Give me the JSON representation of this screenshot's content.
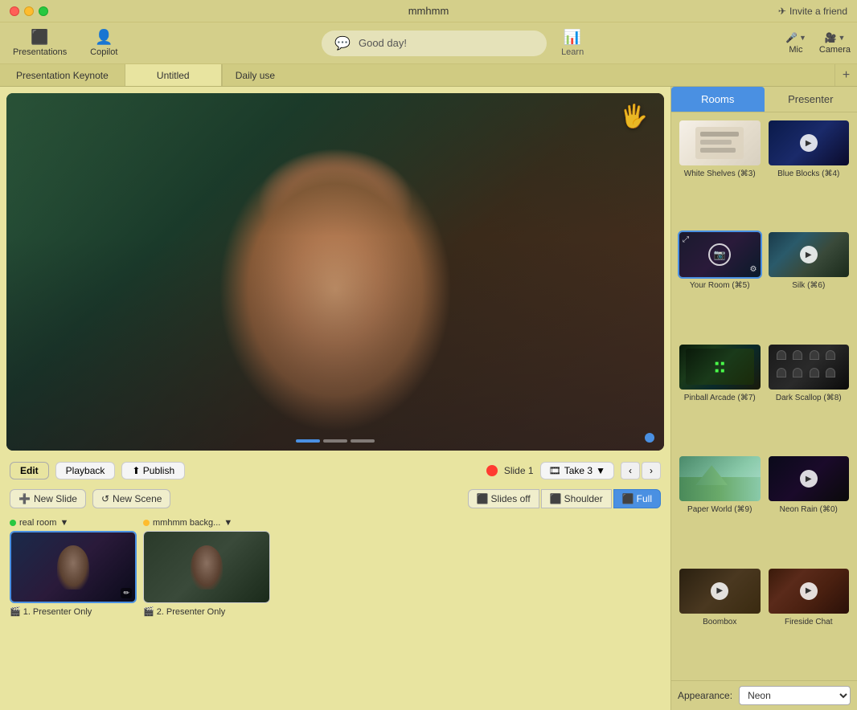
{
  "titlebar": {
    "title": "mmhmm",
    "invite_label": "Invite a friend"
  },
  "toolbar": {
    "presentations_label": "Presentations",
    "copilot_label": "Copilot",
    "chat_placeholder": "Good day!",
    "learn_label": "Learn",
    "mic_label": "Mic",
    "camera_label": "Camera"
  },
  "tabs": {
    "tab1": "Presentation Keynote",
    "tab2": "Untitled",
    "tab3": "Daily use",
    "add_label": "+"
  },
  "right_panel": {
    "rooms_label": "Rooms",
    "presenter_label": "Presenter",
    "rooms": [
      {
        "id": "white-shelves",
        "label": "White Shelves (⌘3)",
        "class": "rt-white-shelves",
        "has_play": false
      },
      {
        "id": "blue-blocks",
        "label": "Blue Blocks (⌘4)",
        "class": "rt-blue-blocks",
        "has_play": true
      },
      {
        "id": "your-room",
        "label": "Your Room (⌘5)",
        "class": "rt-your-room",
        "selected": true,
        "has_camera": true
      },
      {
        "id": "silk",
        "label": "Silk (⌘6)",
        "class": "rt-silk",
        "has_play": true
      },
      {
        "id": "pinball-arcade",
        "label": "Pinball Arcade (⌘7)",
        "class": "rt-pinball",
        "has_play": false
      },
      {
        "id": "dark-scallop",
        "label": "Dark Scallop (⌘8)",
        "class": "rt-dark-scallop",
        "has_play": false
      },
      {
        "id": "paper-world",
        "label": "Paper World (⌘9)",
        "class": "rt-paper-world",
        "has_play": false
      },
      {
        "id": "neon-rain",
        "label": "Neon Rain (⌘0)",
        "class": "rt-neon-rain",
        "has_play": true
      },
      {
        "id": "boombox",
        "label": "Boombox",
        "class": "rt-boombox",
        "has_play": true
      },
      {
        "id": "fireside-chat",
        "label": "Fireside Chat",
        "class": "rt-fireside",
        "has_play": true
      }
    ],
    "appearance_label": "Appearance:",
    "appearance_value": "Neon"
  },
  "playback": {
    "edit_label": "Edit",
    "playback_label": "Playback",
    "publish_label": "Publish",
    "slide_label": "Slide 1",
    "take_label": "Take 3",
    "prev_arrow": "‹",
    "next_arrow": "›"
  },
  "scenes": {
    "new_slide_label": "New Slide",
    "new_scene_label": "New Scene",
    "slides_off_label": "Slides off",
    "shoulder_label": "Shoulder",
    "full_label": "Full"
  },
  "thumbnails": [
    {
      "dot_color": "green",
      "room_name": "real room",
      "label": "1. Presenter Only",
      "active": true
    },
    {
      "dot_color": "yellow",
      "room_name": "mmhmm backg...",
      "label": "2. Presenter Only",
      "active": false
    }
  ]
}
